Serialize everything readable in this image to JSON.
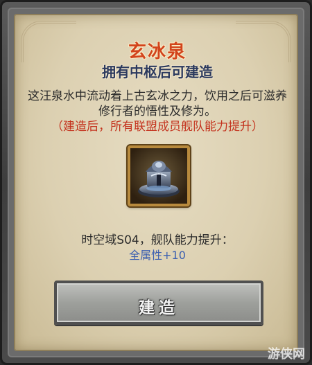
{
  "panel": {
    "title": "玄冰泉",
    "subtitle": "拥有中枢后可建造",
    "description": "这汪泉水中流动着上古玄冰之力，饮用之后可滋养修行者的悟性及修为。",
    "note": "（建造后，所有联盟成员舰队能力提升）",
    "icon": "ice-fountain-icon",
    "effect_label": "时空域S04，舰队能力提升：",
    "bonus_text": "全属性+10",
    "build_button_label": "建造"
  },
  "watermark": "游侠网",
  "colors": {
    "title": "#d2441c",
    "subtitle": "#2c3a5e",
    "note": "#c4341f",
    "bonus": "#3b5fb0",
    "parchment": "#dcd0b1"
  }
}
